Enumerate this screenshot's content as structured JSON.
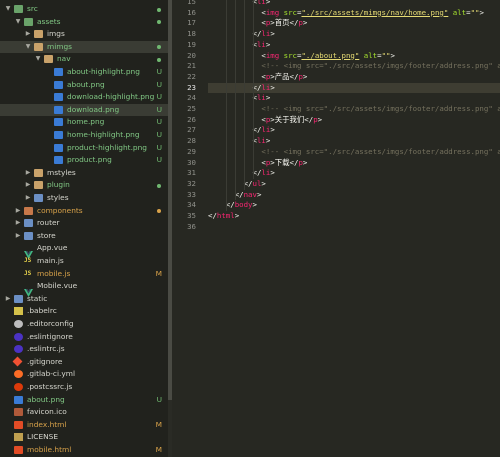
{
  "sidebar": {
    "items": [
      {
        "label": "src",
        "indent": 0,
        "expanded": true,
        "icon": "folder-icon",
        "status": "dot",
        "color": "green",
        "selected": false
      },
      {
        "label": "assets",
        "indent": 1,
        "expanded": true,
        "icon": "folder-icon",
        "status": "dot",
        "color": "green",
        "selected": false
      },
      {
        "label": "imgs",
        "indent": 2,
        "expanded": false,
        "icon": "folder-icon",
        "status": "",
        "color": "gray",
        "selected": false
      },
      {
        "label": "mimgs",
        "indent": 2,
        "expanded": true,
        "icon": "folder-icon",
        "status": "dot",
        "color": "green",
        "selected": true
      },
      {
        "label": "nav",
        "indent": 3,
        "expanded": true,
        "icon": "folder-icon",
        "status": "dot",
        "color": "green",
        "selected": false
      },
      {
        "label": "about-highlight.png",
        "indent": 4,
        "expanded": null,
        "icon": "image-file-icon",
        "status": "U",
        "color": "green",
        "selected": false
      },
      {
        "label": "about.png",
        "indent": 4,
        "expanded": null,
        "icon": "image-file-icon",
        "status": "U",
        "color": "green",
        "selected": false
      },
      {
        "label": "download-highlight.png",
        "indent": 4,
        "expanded": null,
        "icon": "image-file-icon",
        "status": "U",
        "color": "green",
        "selected": false
      },
      {
        "label": "download.png",
        "indent": 4,
        "expanded": null,
        "icon": "image-file-icon",
        "status": "U",
        "color": "green",
        "selected": true
      },
      {
        "label": "home.png",
        "indent": 4,
        "expanded": null,
        "icon": "image-file-icon",
        "status": "U",
        "color": "green",
        "selected": false
      },
      {
        "label": "home-highlight.png",
        "indent": 4,
        "expanded": null,
        "icon": "image-file-icon",
        "status": "U",
        "color": "green",
        "selected": false
      },
      {
        "label": "product-highlight.png",
        "indent": 4,
        "expanded": null,
        "icon": "image-file-icon",
        "status": "U",
        "color": "green",
        "selected": false
      },
      {
        "label": "product.png",
        "indent": 4,
        "expanded": null,
        "icon": "image-file-icon",
        "status": "U",
        "color": "green",
        "selected": false
      },
      {
        "label": "mstyles",
        "indent": 2,
        "expanded": false,
        "icon": "folder-icon",
        "status": "",
        "color": "gray",
        "selected": false
      },
      {
        "label": "plugin",
        "indent": 2,
        "expanded": false,
        "icon": "folder-icon",
        "status": "dot",
        "color": "green",
        "selected": false
      },
      {
        "label": "styles",
        "indent": 2,
        "expanded": false,
        "icon": "folder-icon",
        "status": "",
        "color": "gray",
        "selected": false
      },
      {
        "label": "components",
        "indent": 1,
        "expanded": false,
        "icon": "folder-icon",
        "status": "dot",
        "color": "orange",
        "selected": false
      },
      {
        "label": "router",
        "indent": 1,
        "expanded": false,
        "icon": "folder-icon",
        "status": "",
        "color": "gray",
        "selected": false
      },
      {
        "label": "store",
        "indent": 1,
        "expanded": false,
        "icon": "folder-icon",
        "status": "",
        "color": "gray",
        "selected": false
      },
      {
        "label": "App.vue",
        "indent": 1,
        "expanded": null,
        "icon": "vue-file-icon",
        "status": "",
        "color": "gray",
        "selected": false
      },
      {
        "label": "main.js",
        "indent": 1,
        "expanded": null,
        "icon": "js-file-icon",
        "status": "",
        "color": "gray",
        "selected": false
      },
      {
        "label": "mobile.js",
        "indent": 1,
        "expanded": null,
        "icon": "js-file-icon",
        "status": "M",
        "color": "orange",
        "selected": false
      },
      {
        "label": "Mobile.vue",
        "indent": 1,
        "expanded": null,
        "icon": "vue-file-icon",
        "status": "",
        "color": "gray",
        "selected": false
      },
      {
        "label": "static",
        "indent": 0,
        "expanded": false,
        "icon": "folder-icon",
        "status": "",
        "color": "gray",
        "selected": false
      },
      {
        "label": ".babelrc",
        "indent": 0,
        "expanded": null,
        "icon": "babel-file-icon",
        "status": "",
        "color": "gray",
        "selected": false
      },
      {
        "label": ".editorconfig",
        "indent": 0,
        "expanded": null,
        "icon": "editorconfig-icon",
        "status": "",
        "color": "gray",
        "selected": false
      },
      {
        "label": ".eslintignore",
        "indent": 0,
        "expanded": null,
        "icon": "eslint-icon",
        "status": "",
        "color": "gray",
        "selected": false
      },
      {
        "label": ".eslintrc.js",
        "indent": 0,
        "expanded": null,
        "icon": "eslint-icon",
        "status": "",
        "color": "gray",
        "selected": false
      },
      {
        "label": ".gitignore",
        "indent": 0,
        "expanded": null,
        "icon": "git-icon",
        "status": "",
        "color": "gray",
        "selected": false
      },
      {
        "label": ".gitlab-ci.yml",
        "indent": 0,
        "expanded": null,
        "icon": "gitlab-icon",
        "status": "",
        "color": "gray",
        "selected": false
      },
      {
        "label": ".postcssrc.js",
        "indent": 0,
        "expanded": null,
        "icon": "postcss-icon",
        "status": "",
        "color": "gray",
        "selected": false
      },
      {
        "label": "about.png",
        "indent": 0,
        "expanded": null,
        "icon": "image-file-icon",
        "status": "U",
        "color": "green",
        "selected": false
      },
      {
        "label": "favicon.ico",
        "indent": 0,
        "expanded": null,
        "icon": "favicon-icon",
        "status": "",
        "color": "gray",
        "selected": false
      },
      {
        "label": "index.html",
        "indent": 0,
        "expanded": null,
        "icon": "html-file-icon",
        "status": "M",
        "color": "orange",
        "selected": false
      },
      {
        "label": "LICENSE",
        "indent": 0,
        "expanded": null,
        "icon": "license-icon",
        "status": "",
        "color": "gray",
        "selected": false
      },
      {
        "label": "mobile.html",
        "indent": 0,
        "expanded": null,
        "icon": "html-file-icon",
        "status": "M",
        "color": "orange",
        "selected": false
      }
    ]
  },
  "editor": {
    "active_line": "23",
    "lines": [
      {
        "n": "15",
        "indent": 10,
        "tokens": [
          [
            "pu",
            "<"
          ],
          [
            "tg",
            "li"
          ],
          [
            "pu",
            ">"
          ]
        ]
      },
      {
        "n": "16",
        "indent": 12,
        "tokens": [
          [
            "pu",
            "<"
          ],
          [
            "tg",
            "img"
          ],
          [
            "pu",
            " "
          ],
          [
            "at",
            "src"
          ],
          [
            "pu",
            "="
          ],
          [
            "st-u",
            "\"./src/assets/mimgs/nav/home.png\""
          ],
          [
            "pu",
            " "
          ],
          [
            "at",
            "alt"
          ],
          [
            "pu",
            "="
          ],
          [
            "st",
            "\"\""
          ],
          [
            "pu",
            ">"
          ]
        ]
      },
      {
        "n": "17",
        "indent": 12,
        "tokens": [
          [
            "pu",
            "<"
          ],
          [
            "tg",
            "p"
          ],
          [
            "pu",
            ">首页</"
          ],
          [
            "tg",
            "p"
          ],
          [
            "pu",
            ">"
          ]
        ]
      },
      {
        "n": "18",
        "indent": 10,
        "tokens": [
          [
            "pu",
            "</"
          ],
          [
            "tg",
            "li"
          ],
          [
            "pu",
            ">"
          ]
        ]
      },
      {
        "n": "19",
        "indent": 10,
        "tokens": [
          [
            "pu",
            "<"
          ],
          [
            "tg",
            "li"
          ],
          [
            "pu",
            ">"
          ]
        ]
      },
      {
        "n": "20",
        "indent": 12,
        "tokens": [
          [
            "pu",
            "<"
          ],
          [
            "tg",
            "img"
          ],
          [
            "pu",
            " "
          ],
          [
            "at",
            "src"
          ],
          [
            "pu",
            "="
          ],
          [
            "st-u",
            "\"./about.png\""
          ],
          [
            "pu",
            " "
          ],
          [
            "at",
            "alt"
          ],
          [
            "pu",
            "="
          ],
          [
            "st",
            "\"\""
          ],
          [
            "pu",
            ">"
          ]
        ]
      },
      {
        "n": "21",
        "indent": 12,
        "tokens": [
          [
            "cm",
            "<!-- <img src=\"./src/assets/imgs/footer/address.png\" alt"
          ]
        ]
      },
      {
        "n": "22",
        "indent": 12,
        "tokens": [
          [
            "pu",
            "<"
          ],
          [
            "tg",
            "p"
          ],
          [
            "pu",
            ">产品</"
          ],
          [
            "tg",
            "p"
          ],
          [
            "pu",
            ">"
          ]
        ]
      },
      {
        "n": "23",
        "indent": 10,
        "tokens": [
          [
            "pu",
            "</"
          ],
          [
            "tg",
            "li"
          ],
          [
            "pu",
            ">"
          ]
        ]
      },
      {
        "n": "24",
        "indent": 10,
        "tokens": [
          [
            "pu",
            "<"
          ],
          [
            "tg",
            "li"
          ],
          [
            "pu",
            ">"
          ]
        ]
      },
      {
        "n": "25",
        "indent": 12,
        "tokens": [
          [
            "cm",
            "<!-- <img src=\"./src/assets/imgs/footer/address.png\" alt"
          ]
        ]
      },
      {
        "n": "26",
        "indent": 12,
        "tokens": [
          [
            "pu",
            "<"
          ],
          [
            "tg",
            "p"
          ],
          [
            "pu",
            ">关于我们</"
          ],
          [
            "tg",
            "p"
          ],
          [
            "pu",
            ">"
          ]
        ]
      },
      {
        "n": "27",
        "indent": 10,
        "tokens": [
          [
            "pu",
            "</"
          ],
          [
            "tg",
            "li"
          ],
          [
            "pu",
            ">"
          ]
        ]
      },
      {
        "n": "28",
        "indent": 10,
        "tokens": [
          [
            "pu",
            "<"
          ],
          [
            "tg",
            "li"
          ],
          [
            "pu",
            ">"
          ]
        ]
      },
      {
        "n": "29",
        "indent": 12,
        "tokens": [
          [
            "cm",
            "<!-- <img src=\"./src/assets/imgs/footer/address.png\" alt"
          ]
        ]
      },
      {
        "n": "30",
        "indent": 12,
        "tokens": [
          [
            "pu",
            "<"
          ],
          [
            "tg",
            "p"
          ],
          [
            "pu",
            ">下载</"
          ],
          [
            "tg",
            "p"
          ],
          [
            "pu",
            ">"
          ]
        ]
      },
      {
        "n": "31",
        "indent": 10,
        "tokens": [
          [
            "pu",
            "</"
          ],
          [
            "tg",
            "li"
          ],
          [
            "pu",
            ">"
          ]
        ]
      },
      {
        "n": "32",
        "indent": 8,
        "tokens": [
          [
            "pu",
            "</"
          ],
          [
            "tg",
            "ul"
          ],
          [
            "pu",
            ">"
          ]
        ]
      },
      {
        "n": "33",
        "indent": 6,
        "tokens": [
          [
            "pu",
            "</"
          ],
          [
            "tg",
            "nav"
          ],
          [
            "pu",
            ">"
          ]
        ]
      },
      {
        "n": "34",
        "indent": 4,
        "tokens": [
          [
            "pu",
            "</"
          ],
          [
            "tg",
            "body"
          ],
          [
            "pu",
            ">"
          ]
        ]
      },
      {
        "n": "35",
        "indent": 0,
        "tokens": [
          [
            "pu",
            "</"
          ],
          [
            "tg",
            "html"
          ],
          [
            "pu",
            ">"
          ]
        ]
      },
      {
        "n": "36",
        "indent": 0,
        "tokens": []
      }
    ]
  },
  "colors": {
    "sidebar_bg": "#21221d",
    "editor_bg": "#272822",
    "selected_row": "#3a3c34",
    "git_untracked": "#81c784",
    "git_modified": "#d8a24a"
  }
}
